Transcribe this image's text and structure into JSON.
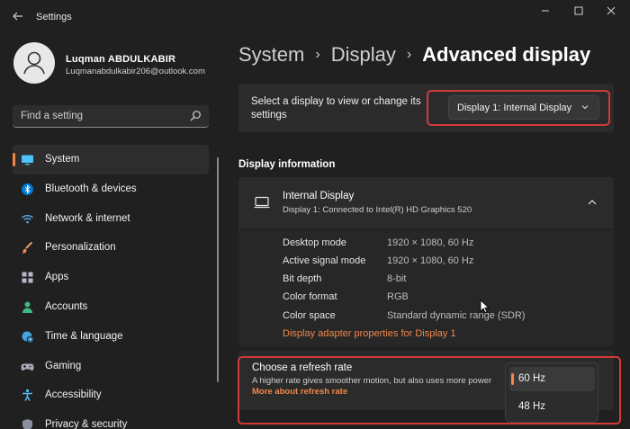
{
  "window": {
    "title": "Settings"
  },
  "user": {
    "name": "Luqman ABDULKABIR",
    "email": "Luqmanabdulkabir206@outlook.com"
  },
  "search": {
    "placeholder": "Find a setting"
  },
  "sidebar": {
    "items": [
      {
        "label": "System",
        "icon": "monitor-icon",
        "active": true
      },
      {
        "label": "Bluetooth & devices",
        "icon": "bluetooth-icon"
      },
      {
        "label": "Network & internet",
        "icon": "wifi-icon"
      },
      {
        "label": "Personalization",
        "icon": "brush-icon"
      },
      {
        "label": "Apps",
        "icon": "apps-icon"
      },
      {
        "label": "Accounts",
        "icon": "person-icon"
      },
      {
        "label": "Time & language",
        "icon": "globe-clock-icon"
      },
      {
        "label": "Gaming",
        "icon": "gamepad-icon"
      },
      {
        "label": "Accessibility",
        "icon": "accessibility-icon"
      },
      {
        "label": "Privacy & security",
        "icon": "shield-icon"
      }
    ]
  },
  "breadcrumb": {
    "items": [
      "System",
      "Display"
    ],
    "current": "Advanced display"
  },
  "select_display": {
    "label": "Select a display to view or change its settings",
    "value": "Display 1: Internal Display"
  },
  "display_info": {
    "section_title": "Display information",
    "name": "Internal Display",
    "subtitle": "Display 1: Connected to Intel(R) HD Graphics 520",
    "rows": [
      {
        "key": "Desktop mode",
        "value": "1920 × 1080, 60 Hz"
      },
      {
        "key": "Active signal mode",
        "value": "1920 × 1080, 60 Hz"
      },
      {
        "key": "Bit depth",
        "value": "8-bit"
      },
      {
        "key": "Color format",
        "value": "RGB"
      },
      {
        "key": "Color space",
        "value": "Standard dynamic range (SDR)"
      }
    ],
    "adapter_link": "Display adapter properties for Display 1"
  },
  "refresh_rate": {
    "title": "Choose a refresh rate",
    "description": "A higher rate gives smoother motion, but also uses more power",
    "link": "More about refresh rate",
    "options": [
      "60 Hz",
      "48 Hz"
    ],
    "selected": "60 Hz"
  },
  "colors": {
    "accent": "#f0874a",
    "highlight_box": "#d23a3a",
    "background": "#202020",
    "card": "#2b2b2b"
  }
}
